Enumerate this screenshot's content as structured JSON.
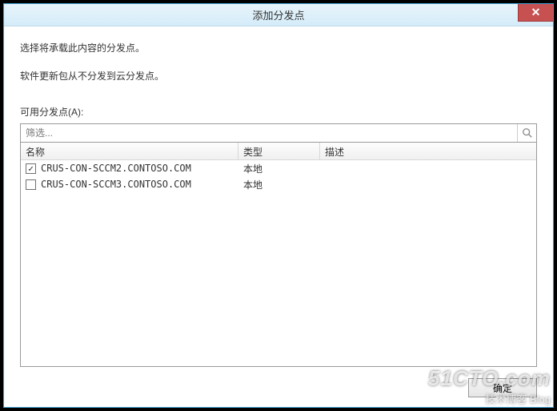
{
  "title": "添加分发点",
  "close_icon": "✕",
  "desc1": "选择将承载此内容的分发点。",
  "desc2": "软件更新包从不分发到云分发点。",
  "available_label": "可用分发点(A):",
  "filter": {
    "placeholder": "筛选..."
  },
  "columns": {
    "name": "名称",
    "type": "类型",
    "desc": "描述"
  },
  "rows": [
    {
      "checked": true,
      "name": "CRUS-CON-SCCM2.CONTOSO.COM",
      "type": "本地",
      "desc": ""
    },
    {
      "checked": false,
      "name": "CRUS-CON-SCCM3.CONTOSO.COM",
      "type": "本地",
      "desc": ""
    }
  ],
  "check_glyph": "✓",
  "buttons": {
    "ok": "确定"
  },
  "watermark": {
    "line1": "51CTO.com",
    "line2": "技术博客   Blog"
  }
}
